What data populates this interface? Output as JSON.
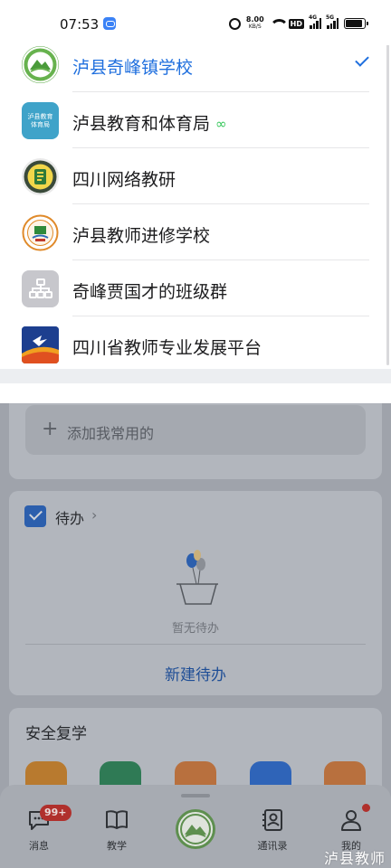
{
  "status_bar": {
    "time": "07:53",
    "net_speed": "8.00",
    "net_speed_unit": "KB/S",
    "hd_label": "HD",
    "sig1_label": "4G",
    "sig2_label": "5G"
  },
  "org_list": {
    "items": [
      {
        "name": "泸县奇峰镇学校",
        "selected": true,
        "icon": "school-logo-icon"
      },
      {
        "name": "泸县教育和体育局",
        "selected": false,
        "linked": true,
        "icon": "bureau-logo-icon",
        "logo_text": "泸县教育体育局"
      },
      {
        "name": "四川网络教研",
        "selected": false,
        "icon": "network-research-logo-icon"
      },
      {
        "name": "泸县教师进修学校",
        "selected": false,
        "icon": "teacher-school-logo-icon"
      },
      {
        "name": "奇峰贾国才的班级群",
        "selected": false,
        "icon": "class-group-icon"
      },
      {
        "name": "四川省教师专业发展平台",
        "selected": false,
        "icon": "platform-logo-icon"
      }
    ],
    "link_glyph": "∞"
  },
  "background": {
    "add_favorite": {
      "icon": "plus-icon",
      "label": "添加我常用的"
    },
    "todo": {
      "title": "待办",
      "chevron": "›",
      "empty_text": "暂无待办",
      "new_label": "新建待办"
    },
    "safe_return": {
      "title": "安全复学"
    },
    "app_icon_colors": [
      "#b87a2f",
      "#2f7a55",
      "#b8703e",
      "#2f64b8",
      "#b8703e"
    ]
  },
  "tabbar": {
    "tabs": [
      {
        "label": "消息",
        "icon": "message-icon"
      },
      {
        "label": "教学",
        "icon": "book-icon"
      },
      {
        "label": "",
        "icon": "home-logo-icon"
      },
      {
        "label": "通讯录",
        "icon": "contacts-icon"
      },
      {
        "label": "我的",
        "icon": "profile-icon"
      }
    ],
    "message_badge": "99+"
  },
  "watermark": "泸县教师",
  "colors": {
    "accent": "#1f6fde",
    "link_green": "#34c759",
    "badge_red": "#b0302c"
  }
}
